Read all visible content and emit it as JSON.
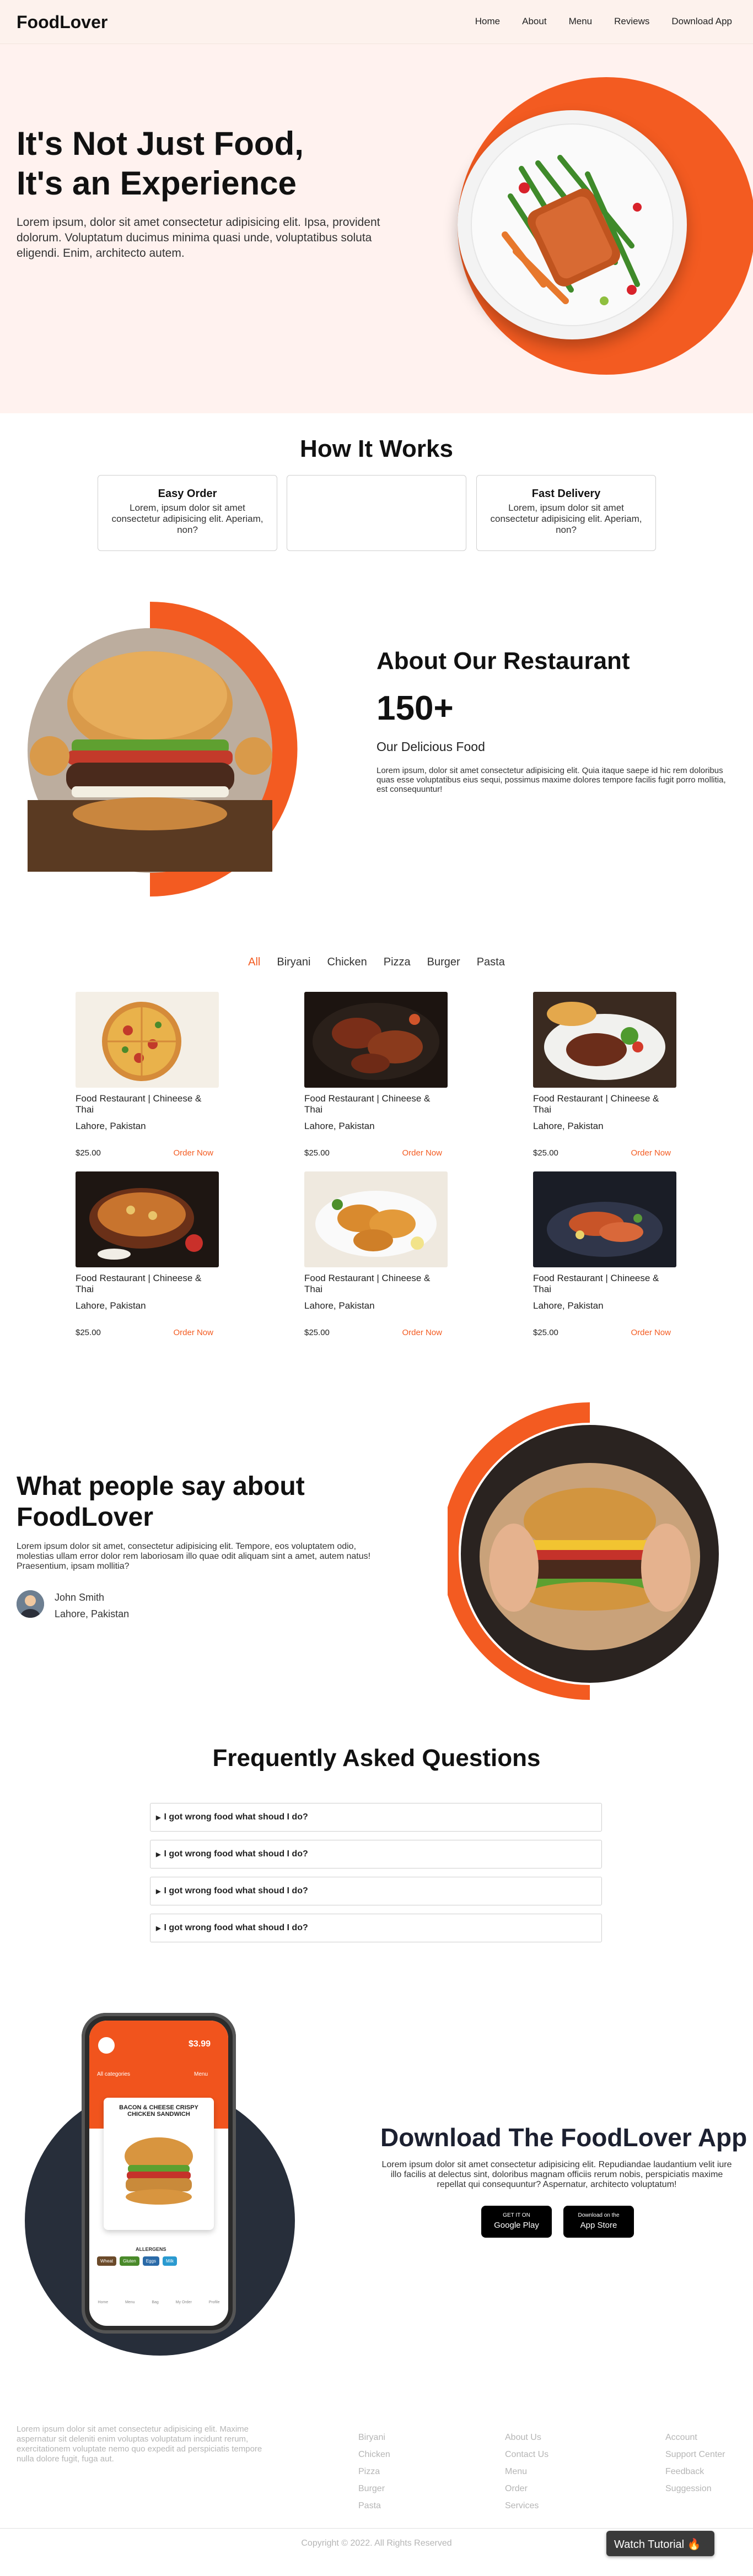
{
  "header": {
    "logo": "FoodLover",
    "nav": [
      "Home",
      "About",
      "Menu",
      "Reviews",
      "Download App"
    ]
  },
  "hero": {
    "title_line1": "It's Not Just Food,",
    "title_line2": "It's an Experience",
    "text": "Lorem ipsum, dolor sit amet consectetur adipisicing elit. Ipsa, provident dolorum. Voluptatum ducimus minima quasi unde, voluptatibus soluta eligendi. Enim, architecto autem.",
    "accent_color": "#f35b21"
  },
  "how": {
    "title": "How It Works",
    "cards": [
      {
        "title": "Easy Order",
        "text": "Lorem, ipsum dolor sit amet consectetur adipisicing elit. Aperiam, non?"
      },
      {
        "title": "",
        "text": ""
      },
      {
        "title": "Fast Delivery",
        "text": "Lorem, ipsum dolor sit amet consectetur adipisicing elit. Aperiam, non?"
      }
    ]
  },
  "about": {
    "title": "About Our Restaurant",
    "number": "150+",
    "subtitle": "Our Delicious Food",
    "text": "Lorem ipsum, dolor sit amet consectetur adipisicing elit. Quia itaque saepe id hic rem doloribus quas esse voluptatibus eius sequi, possimus maxime dolores tempore facilis fugit porro mollitia, est consequuntur!"
  },
  "menu": {
    "filters": [
      "All",
      "Biryani",
      "Chicken",
      "Pizza",
      "Burger",
      "Pasta"
    ],
    "active_filter": "All",
    "items": [
      {
        "name": "Food Restaurant | Chineese & Thai",
        "location": "Lahore, Pakistan",
        "price": "$25.00",
        "action": "Order Now"
      },
      {
        "name": "Food Restaurant | Chineese & Thai",
        "location": "Lahore, Pakistan",
        "price": "$25.00",
        "action": "Order Now"
      },
      {
        "name": "Food Restaurant | Chineese & Thai",
        "location": "Lahore, Pakistan",
        "price": "$25.00",
        "action": "Order Now"
      },
      {
        "name": "Food Restaurant | Chineese & Thai",
        "location": "Lahore, Pakistan",
        "price": "$25.00",
        "action": "Order Now"
      },
      {
        "name": "Food Restaurant | Chineese & Thai",
        "location": "Lahore, Pakistan",
        "price": "$25.00",
        "action": "Order Now"
      },
      {
        "name": "Food Restaurant | Chineese & Thai",
        "location": "Lahore, Pakistan",
        "price": "$25.00",
        "action": "Order Now"
      }
    ]
  },
  "testimonial": {
    "title_line1": "What people say about",
    "title_line2": "FoodLover",
    "text": "Lorem ipsum dolor sit amet, consectetur adipisicing elit. Tempore, eos voluptatem odio, molestias ullam error dolor rem laboriosam illo quae odit aliquam sint a amet, autem natus! Praesentium, ipsam mollitia?",
    "name": "John Smith",
    "location": "Lahore, Pakistan"
  },
  "faq": {
    "title": "Frequently Asked Questions",
    "items": [
      "I got wrong food what shoud I do?",
      "I got wrong food what shoud I do?",
      "I got wrong food what shoud I do?",
      "I got wrong food what shoud I do?"
    ]
  },
  "phone": {
    "price": "$3.99",
    "categories": "All categories",
    "menu": "Menu",
    "promo_line1": "BACON & CHEESE CRISPY",
    "promo_line2": "CHICKEN SANDWICH",
    "allergens": "ALLERGENS",
    "chips": [
      "Wheat",
      "Gluten",
      "Eggs",
      "Milk"
    ],
    "tabs": [
      "Home",
      "Menu",
      "Bag",
      "My Order",
      "Profile"
    ]
  },
  "download": {
    "title": "Download The FoodLover App",
    "text": "Lorem ipsum dolor sit amet consectetur adipisicing elit. Repudiandae laudantium velit iure illo facilis at delectus sint, doloribus magnam officiis rerum nobis, perspiciatis maxime repellat qui consequuntur? Aspernatur, architecto voluptatum!",
    "google_small": "GET IT ON",
    "google_big": "Google Play",
    "apple_small": "Download on the",
    "apple_big": "App Store"
  },
  "footer": {
    "text": "Lorem ipsum dolor sit amet consectetur adipisicing elit. Maxime aspernatur sit deleniti enim voluptas voluptatum incidunt rerum, exercitationem voluptate nemo quo expedit ad perspiciatis tempore nulla dolore fugit, fuga aut.",
    "col1": [
      "Biryani",
      "Chicken",
      "Pizza",
      "Burger",
      "Pasta"
    ],
    "col2": [
      "About Us",
      "Contact Us",
      "Menu",
      "Order",
      "Services"
    ],
    "col3": [
      "Account",
      "Support Center",
      "Feedback",
      "Suggession"
    ],
    "copyright": "Copyright © 2022. All Rights Reserved",
    "tutorial": "Watch Tutorial 🔥"
  }
}
